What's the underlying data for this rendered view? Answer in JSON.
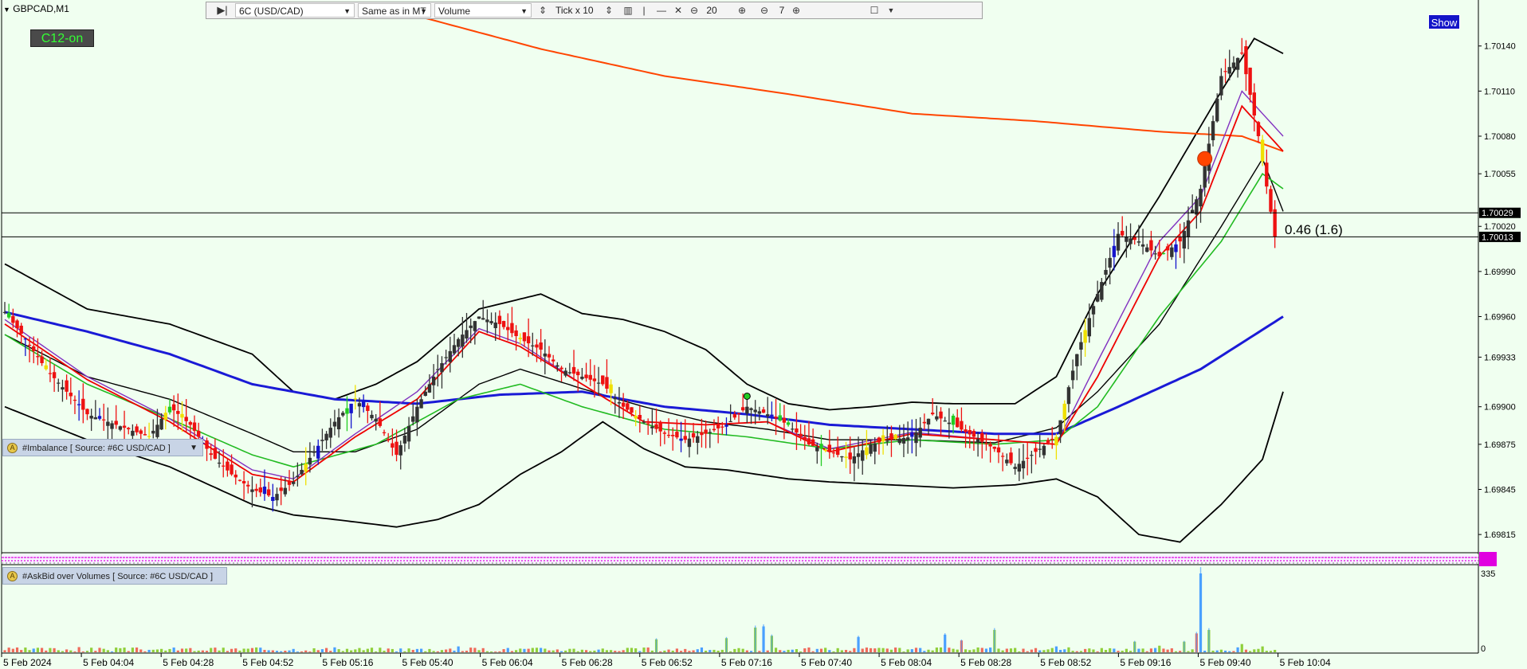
{
  "window": {
    "symbol_title": "GBPCAD,M1",
    "c12_badge": "C12-on",
    "show_button": "Show"
  },
  "toolbar": {
    "instrument": "6C (USD/CAD)",
    "source_mode": "Same as in MT",
    "mode": "Volume",
    "tick_mult": "Tick x 10",
    "zoom_value": "20",
    "depth_value": "7"
  },
  "indicators": {
    "imbalance_label": "#Imbalance [ Source: #6C USD/CAD ]",
    "askbid_label": "#AskBid over Volumes [ Source: #6C USD/CAD ]"
  },
  "colors": {
    "background": "#f0fff0",
    "bull_bar": "#333333",
    "bear_bar": "#ee1111",
    "blue_bar": "#1414cc",
    "yellow_bar": "#f0e000",
    "green_bar": "#22cc22",
    "bollinger": "#000000",
    "ma_long": "#ff4500",
    "ma_blue": "#1a1ad6",
    "ma_green": "#22bb22",
    "ma_red": "#ee0000",
    "ma_purple": "#8030c0",
    "vol_green": "#8fcf3a",
    "vol_red": "#ef6a5a",
    "vol_blue": "#4aa0ff",
    "imbalance_magenta": "#e000e0"
  },
  "chart_data": {
    "type": "line",
    "title": "GBPCAD,M1",
    "xlabel": "",
    "ylabel": "",
    "x_ticks": [
      "5 Feb 2024",
      "5 Feb 04:04",
      "5 Feb 04:28",
      "5 Feb 04:52",
      "5 Feb 05:16",
      "5 Feb 05:40",
      "5 Feb 06:04",
      "5 Feb 06:28",
      "5 Feb 06:52",
      "5 Feb 07:16",
      "5 Feb 07:40",
      "5 Feb 08:04",
      "5 Feb 08:28",
      "5 Feb 08:52",
      "5 Feb 09:16",
      "5 Feb 09:40",
      "5 Feb 10:04"
    ],
    "y_ticks": [
      "1.70140",
      "1.70110",
      "1.70080",
      "1.70055",
      "1.70020",
      "1.69990",
      "1.69960",
      "1.69933",
      "1.69900",
      "1.69875",
      "1.69845",
      "1.69815"
    ],
    "ylim": [
      1.69805,
      1.7016
    ],
    "price_line_labels": [
      {
        "label": "1.70029",
        "value": 1.70029
      },
      {
        "label": "1.70013",
        "value": 1.70013
      }
    ],
    "annotation": "0.46 (1.6)",
    "price_series": [
      {
        "name": "close",
        "points": [
          [
            0,
            1.69963
          ],
          [
            5,
            1.69945
          ],
          [
            10,
            1.69925
          ],
          [
            15,
            1.6991
          ],
          [
            20,
            1.69895
          ],
          [
            25,
            1.6989
          ],
          [
            30,
            1.69885
          ],
          [
            35,
            1.6988
          ],
          [
            40,
            1.699
          ],
          [
            45,
            1.69888
          ],
          [
            50,
            1.69868
          ],
          [
            55,
            1.69855
          ],
          [
            60,
            1.69845
          ],
          [
            65,
            1.6984
          ],
          [
            70,
            1.6985
          ],
          [
            75,
            1.6987
          ],
          [
            80,
            1.6989
          ],
          [
            85,
            1.69905
          ],
          [
            90,
            1.69892
          ],
          [
            95,
            1.69868
          ],
          [
            100,
            1.699
          ],
          [
            105,
            1.69925
          ],
          [
            110,
            1.69945
          ],
          [
            115,
            1.6996
          ],
          [
            120,
            1.69955
          ],
          [
            125,
            1.69945
          ],
          [
            130,
            1.69938
          ],
          [
            135,
            1.69925
          ],
          [
            140,
            1.6992
          ],
          [
            145,
            1.69915
          ],
          [
            150,
            1.699
          ],
          [
            155,
            1.6989
          ],
          [
            160,
            1.69882
          ],
          [
            165,
            1.69878
          ],
          [
            170,
            1.69882
          ],
          [
            175,
            1.69888
          ],
          [
            180,
            1.699
          ],
          [
            185,
            1.69895
          ],
          [
            190,
            1.69888
          ],
          [
            195,
            1.69875
          ],
          [
            200,
            1.6987
          ],
          [
            205,
            1.69865
          ],
          [
            210,
            1.69875
          ],
          [
            215,
            1.69878
          ],
          [
            220,
            1.6988
          ],
          [
            225,
            1.69895
          ],
          [
            230,
            1.69888
          ],
          [
            235,
            1.6988
          ],
          [
            240,
            1.69872
          ],
          [
            245,
            1.6986
          ],
          [
            250,
            1.6987
          ],
          [
            255,
            1.6988
          ],
          [
            260,
            1.69935
          ],
          [
            265,
            1.69975
          ],
          [
            270,
            1.70015
          ],
          [
            275,
            1.7001
          ],
          [
            280,
            1.7
          ],
          [
            285,
            1.7001
          ],
          [
            290,
            1.70045
          ],
          [
            295,
            1.7012
          ],
          [
            300,
            1.70135
          ],
          [
            304,
            1.7008
          ],
          [
            308,
            1.70013
          ]
        ]
      }
    ],
    "bollinger_upper": [
      [
        0,
        1.69995
      ],
      [
        20,
        1.69965
      ],
      [
        40,
        1.69955
      ],
      [
        60,
        1.69935
      ],
      [
        70,
        1.6991
      ],
      [
        80,
        1.69905
      ],
      [
        90,
        1.69915
      ],
      [
        100,
        1.6993
      ],
      [
        115,
        1.69965
      ],
      [
        130,
        1.69975
      ],
      [
        140,
        1.69962
      ],
      [
        150,
        1.69958
      ],
      [
        160,
        1.6995
      ],
      [
        170,
        1.69938
      ],
      [
        180,
        1.69915
      ],
      [
        190,
        1.69902
      ],
      [
        200,
        1.69898
      ],
      [
        210,
        1.699
      ],
      [
        220,
        1.69903
      ],
      [
        230,
        1.69902
      ],
      [
        245,
        1.69902
      ],
      [
        255,
        1.6992
      ],
      [
        265,
        1.69975
      ],
      [
        280,
        1.7004
      ],
      [
        295,
        1.7011
      ],
      [
        303,
        1.70145
      ],
      [
        310,
        1.70135
      ]
    ],
    "bollinger_lower": [
      [
        0,
        1.699
      ],
      [
        20,
        1.69878
      ],
      [
        40,
        1.6986
      ],
      [
        60,
        1.69835
      ],
      [
        70,
        1.69828
      ],
      [
        80,
        1.69825
      ],
      [
        95,
        1.6982
      ],
      [
        105,
        1.69825
      ],
      [
        115,
        1.69835
      ],
      [
        125,
        1.69855
      ],
      [
        135,
        1.6987
      ],
      [
        145,
        1.6989
      ],
      [
        155,
        1.69872
      ],
      [
        165,
        1.6986
      ],
      [
        175,
        1.69858
      ],
      [
        190,
        1.69852
      ],
      [
        200,
        1.6985
      ],
      [
        215,
        1.69848
      ],
      [
        230,
        1.69846
      ],
      [
        245,
        1.69848
      ],
      [
        255,
        1.69852
      ],
      [
        265,
        1.6984
      ],
      [
        275,
        1.69815
      ],
      [
        285,
        1.6981
      ],
      [
        295,
        1.69835
      ],
      [
        305,
        1.69865
      ],
      [
        310,
        1.6991
      ]
    ],
    "bollinger_mid": [
      [
        0,
        1.69948
      ],
      [
        20,
        1.6992
      ],
      [
        40,
        1.69905
      ],
      [
        60,
        1.69882
      ],
      [
        70,
        1.6987
      ],
      [
        85,
        1.6987
      ],
      [
        100,
        1.69885
      ],
      [
        115,
        1.69915
      ],
      [
        125,
        1.69925
      ],
      [
        140,
        1.69912
      ],
      [
        155,
        1.699
      ],
      [
        170,
        1.6989
      ],
      [
        185,
        1.69885
      ],
      [
        200,
        1.69878
      ],
      [
        220,
        1.69878
      ],
      [
        240,
        1.69876
      ],
      [
        255,
        1.69886
      ],
      [
        265,
        1.6991
      ],
      [
        280,
        1.69955
      ],
      [
        295,
        1.7002
      ],
      [
        305,
        1.70065
      ],
      [
        310,
        1.7003
      ]
    ],
    "ma_long": [
      [
        100,
        1.7016
      ],
      [
        130,
        1.70138
      ],
      [
        160,
        1.7012
      ],
      [
        190,
        1.70108
      ],
      [
        220,
        1.70095
      ],
      [
        250,
        1.7009
      ],
      [
        280,
        1.70083
      ],
      [
        300,
        1.7008
      ],
      [
        310,
        1.7007
      ]
    ],
    "ma_blue": [
      [
        0,
        1.69963
      ],
      [
        20,
        1.6995
      ],
      [
        40,
        1.69935
      ],
      [
        60,
        1.69915
      ],
      [
        80,
        1.69905
      ],
      [
        100,
        1.69902
      ],
      [
        120,
        1.69908
      ],
      [
        140,
        1.6991
      ],
      [
        160,
        1.699
      ],
      [
        180,
        1.69895
      ],
      [
        200,
        1.69888
      ],
      [
        220,
        1.69885
      ],
      [
        240,
        1.69882
      ],
      [
        255,
        1.69882
      ],
      [
        270,
        1.699
      ],
      [
        290,
        1.69925
      ],
      [
        310,
        1.6996
      ]
    ],
    "ma_green": [
      [
        0,
        1.69948
      ],
      [
        20,
        1.69915
      ],
      [
        40,
        1.69892
      ],
      [
        60,
        1.69868
      ],
      [
        70,
        1.6986
      ],
      [
        90,
        1.69875
      ],
      [
        110,
        1.69905
      ],
      [
        125,
        1.69915
      ],
      [
        140,
        1.699
      ],
      [
        160,
        1.69885
      ],
      [
        180,
        1.6988
      ],
      [
        200,
        1.69872
      ],
      [
        220,
        1.69878
      ],
      [
        240,
        1.69875
      ],
      [
        255,
        1.69878
      ],
      [
        265,
        1.699
      ],
      [
        280,
        1.6996
      ],
      [
        295,
        1.7001
      ],
      [
        305,
        1.70055
      ],
      [
        310,
        1.70045
      ]
    ],
    "ma_red": [
      [
        0,
        1.69955
      ],
      [
        20,
        1.69918
      ],
      [
        40,
        1.6989
      ],
      [
        60,
        1.69855
      ],
      [
        70,
        1.6985
      ],
      [
        85,
        1.6988
      ],
      [
        100,
        1.69905
      ],
      [
        115,
        1.6995
      ],
      [
        125,
        1.6994
      ],
      [
        140,
        1.69915
      ],
      [
        155,
        1.6989
      ],
      [
        170,
        1.69888
      ],
      [
        185,
        1.6989
      ],
      [
        200,
        1.6987
      ],
      [
        220,
        1.69882
      ],
      [
        240,
        1.69878
      ],
      [
        255,
        1.69875
      ],
      [
        265,
        1.6992
      ],
      [
        280,
        1.7
      ],
      [
        290,
        1.7003
      ],
      [
        300,
        1.701
      ],
      [
        310,
        1.7007
      ]
    ],
    "ma_purple": [
      [
        0,
        1.69958
      ],
      [
        20,
        1.6992
      ],
      [
        40,
        1.69892
      ],
      [
        60,
        1.69858
      ],
      [
        70,
        1.69852
      ],
      [
        85,
        1.69882
      ],
      [
        100,
        1.6991
      ],
      [
        115,
        1.69952
      ],
      [
        125,
        1.69942
      ],
      [
        140,
        1.69915
      ],
      [
        155,
        1.6989
      ],
      [
        170,
        1.69888
      ],
      [
        185,
        1.6989
      ],
      [
        200,
        1.69872
      ],
      [
        220,
        1.69883
      ],
      [
        240,
        1.69878
      ],
      [
        255,
        1.69875
      ],
      [
        265,
        1.6993
      ],
      [
        280,
        1.7001
      ],
      [
        290,
        1.7004
      ],
      [
        300,
        1.7011
      ],
      [
        310,
        1.7008
      ]
    ],
    "marker_big": {
      "t": 291,
      "y": 1.70065
    },
    "marker_small": {
      "t": 180,
      "y": 1.69907
    },
    "volume_axis": {
      "max_label": "335",
      "min_label": "0",
      "max": 335
    },
    "volume_spikes": [
      {
        "t": 18,
        "v": 22
      },
      {
        "t": 60,
        "v": 18
      },
      {
        "t": 110,
        "v": 25
      },
      {
        "t": 158,
        "v": 55
      },
      {
        "t": 175,
        "v": 60
      },
      {
        "t": 182,
        "v": 105
      },
      {
        "t": 184,
        "v": 110
      },
      {
        "t": 186,
        "v": 70
      },
      {
        "t": 207,
        "v": 65
      },
      {
        "t": 228,
        "v": 75
      },
      {
        "t": 232,
        "v": 50
      },
      {
        "t": 240,
        "v": 95
      },
      {
        "t": 255,
        "v": 25
      },
      {
        "t": 274,
        "v": 45
      },
      {
        "t": 280,
        "v": 28
      },
      {
        "t": 286,
        "v": 45
      },
      {
        "t": 289,
        "v": 80
      },
      {
        "t": 290,
        "v": 335
      },
      {
        "t": 292,
        "v": 95
      },
      {
        "t": 300,
        "v": 35
      },
      {
        "t": 305,
        "v": 25
      }
    ]
  }
}
